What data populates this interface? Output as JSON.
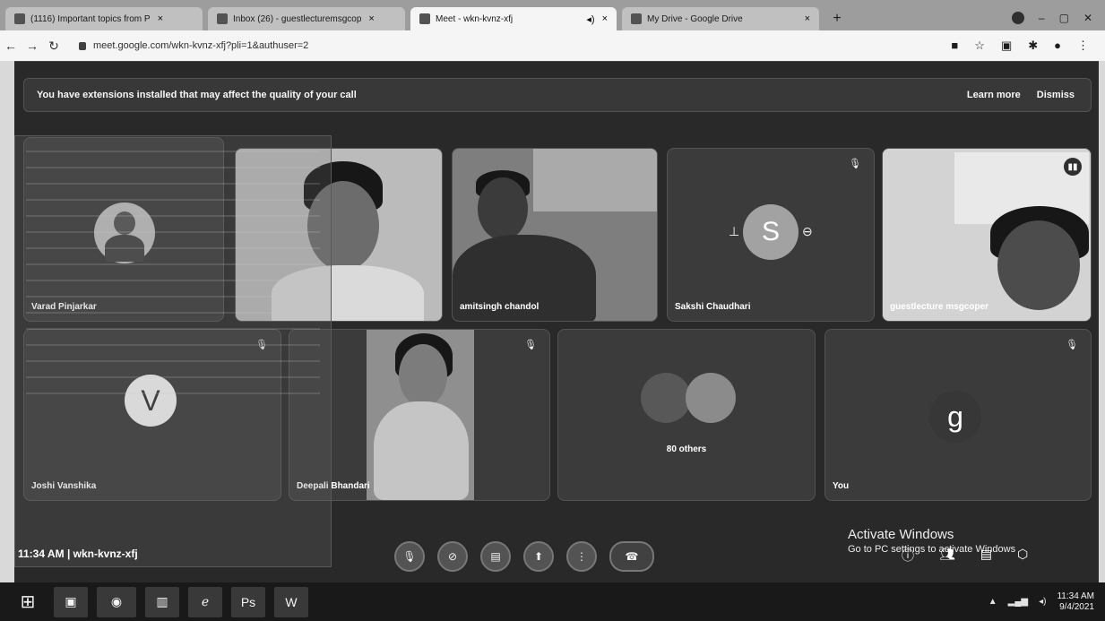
{
  "browser": {
    "tabs": [
      {
        "label": "(1116) Important topics from P",
        "active": false
      },
      {
        "label": "Inbox (26) - guestlecturemsgcop",
        "active": false
      },
      {
        "label": "Meet - wkn-kvnz-xfj",
        "active": true
      },
      {
        "label": "My Drive - Google Drive",
        "active": false
      }
    ],
    "url": "meet.google.com/wkn-kvnz-xfj?pli=1&authuser=2"
  },
  "banner": {
    "message": "You have extensions installed that may affect the quality of your call",
    "learn_more": "Learn more",
    "dismiss": "Dismiss"
  },
  "participants": [
    {
      "name": "Varad Pinjarkar",
      "type": "photo-avatar"
    },
    {
      "name": "",
      "type": "video"
    },
    {
      "name": "amitsingh chandol",
      "type": "video"
    },
    {
      "name": "Sakshi Chaudhari",
      "type": "letter-avatar",
      "initial": "S"
    },
    {
      "name": "guestlecture msgcoper",
      "type": "video"
    },
    {
      "name": "Joshi Vanshika",
      "type": "letter-avatar",
      "initial": "V"
    },
    {
      "name": "Deepali Bhandari",
      "type": "video"
    },
    {
      "name": "80 others",
      "type": "group"
    },
    {
      "name": "You",
      "type": "letter-avatar",
      "initial": "g"
    }
  ],
  "meeting": {
    "time": "11:34 AM",
    "separator": "|",
    "code": "wkn-kvnz-xfj"
  },
  "watermark": {
    "line1": "Activate Windows",
    "line2": "Go to PC settings to activate Windows"
  },
  "taskbar": {
    "time": "11:34 AM",
    "date": "9/4/2021"
  }
}
